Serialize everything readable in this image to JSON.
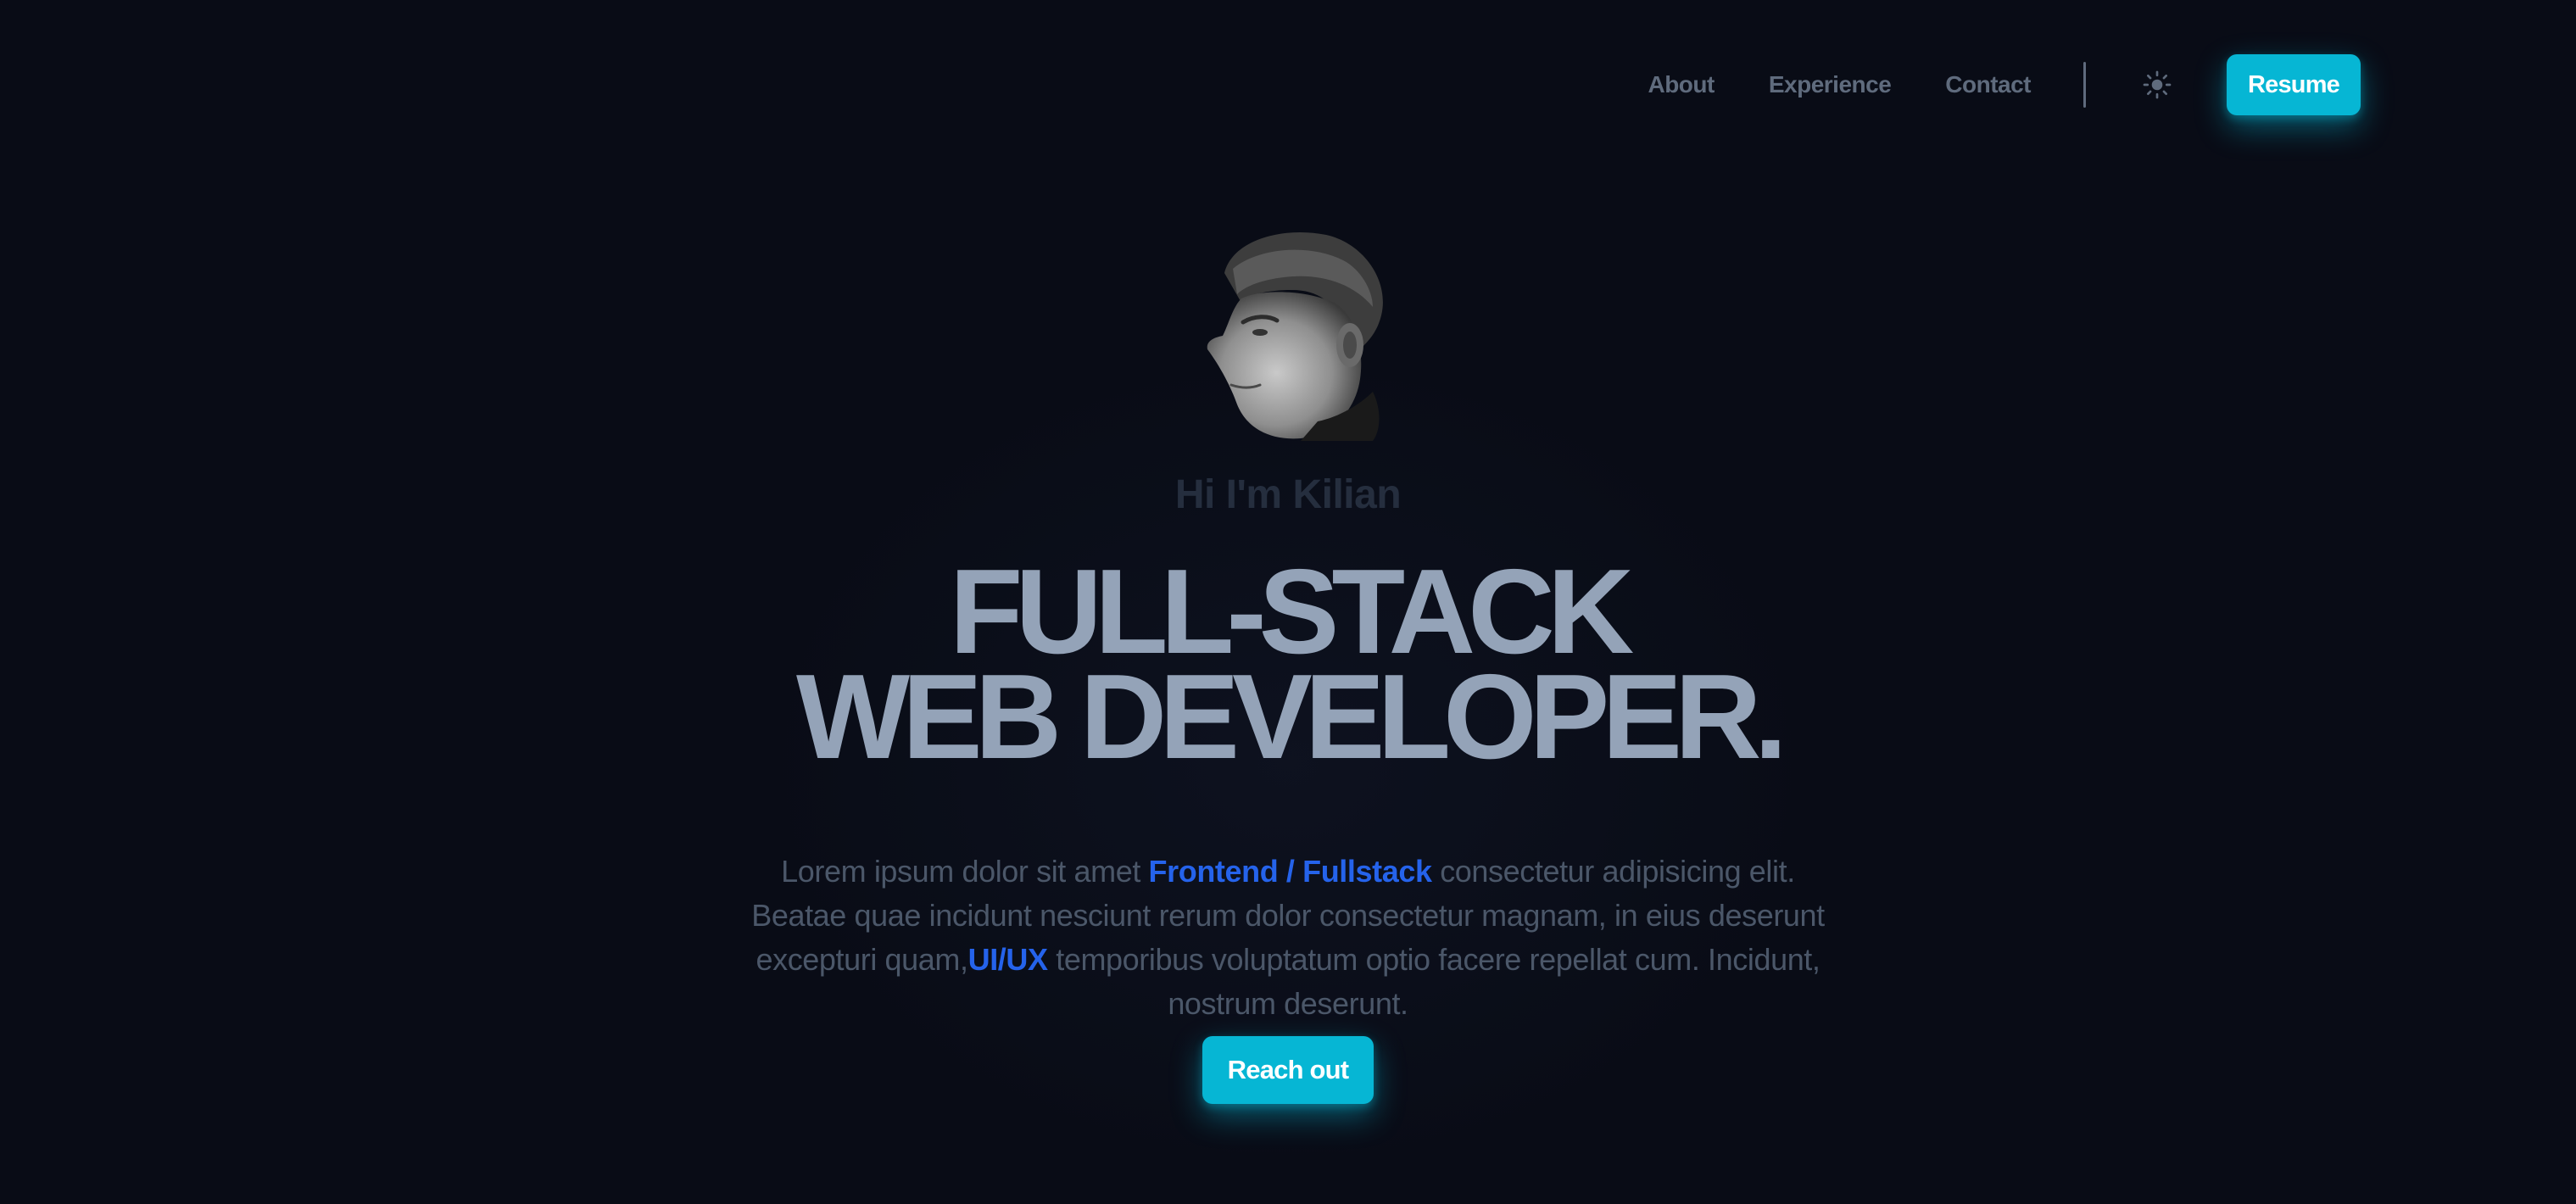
{
  "nav": {
    "links": [
      "About",
      "Experience",
      "Contact"
    ],
    "theme_icon": "sun-icon",
    "resume_label": "Resume"
  },
  "hero": {
    "greeting": "Hi I'm Kilian",
    "headline_line1": "FULL-STACK",
    "headline_line2": "WEB DEVELOPER.",
    "intro_part1": "Lorem ipsum dolor sit amet ",
    "intro_highlight1": "Frontend / Fullstack",
    "intro_part2": " consectetur adipisicing elit. Beatae quae incidunt nesciunt rerum dolor consectetur magnam, in eius deserunt excepturi quam,",
    "intro_highlight2": "UI/UX",
    "intro_part3": " temporibus voluptatum optio facere repellat cum. Incidunt, nostrum deserunt.",
    "cta_label": "Reach out"
  },
  "colors": {
    "background": "#090c16",
    "accent": "#06b6d4",
    "highlight": "#2563eb",
    "headline": "#94a3b8",
    "muted_text": "#4b5769"
  }
}
